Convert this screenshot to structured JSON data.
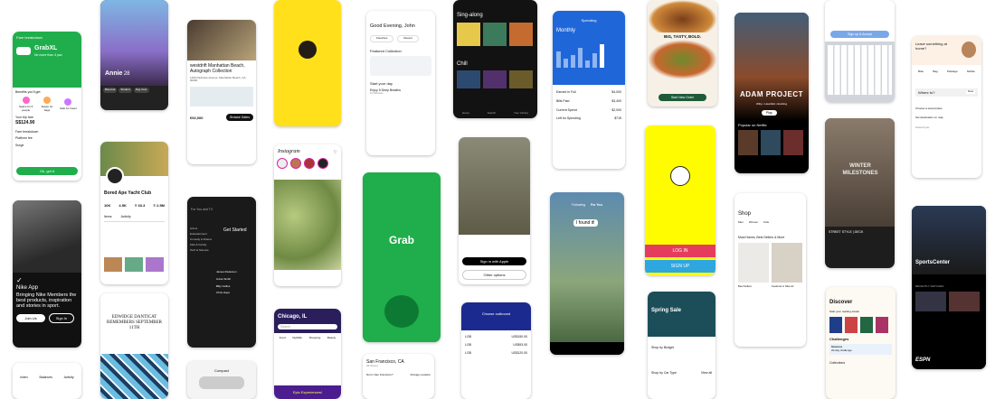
{
  "colors": {
    "grab": "#1fae4b",
    "snap": "#fffc00",
    "spend": "#1f66d9",
    "netflix": "#e50914"
  },
  "grabfood": {
    "title": "Fare breakdown",
    "tier": "GrabXL",
    "sub": "No more than 4 pax",
    "benefits": "Benefits you'll get:",
    "b1": "Space for 6 people",
    "b2": "Space for bags",
    "b3": "Safe for travel",
    "trip": "Your trip fare",
    "fare": "S$124.90",
    "rows": [
      "Fare breakdown",
      "Platform fee",
      "Surge"
    ],
    "cta": "Ok, got it"
  },
  "nike": {
    "title": "Nike App",
    "body": "Bringing Nike Members the best products, inspiration and stories in sport.",
    "join": "Join Us",
    "signin": "Sign In"
  },
  "bumble": {
    "name": "Annie",
    "age": "28",
    "tags": [
      "Bisexual",
      "Student",
      "Dog lover",
      "Rock"
    ]
  },
  "opensea": {
    "name": "Bored Ape Yacht Club",
    "stats": [
      "10K",
      "4.5K",
      "Ξ 63.3",
      "Ξ 2.5M"
    ],
    "tab": "Items",
    "tab2": "Activity"
  },
  "medium": {
    "headline": "EDWIDGE DANTICAT REMEMBERS SEPTEMBER 11TH"
  },
  "airbnb": {
    "title": "westdrift Manhattan Beach, Autograph Collection",
    "address": "1400 Parkview Avenue, Manhattan Beach, CA, 90266",
    "price": "€92,000",
    "cta": "Browse Dates"
  },
  "instagram": {
    "logo": "Instagram"
  },
  "tvapp": {
    "search": "For You and TV",
    "cta": "Get Started",
    "menu": [
      "Arts & Entertainment",
      "Comedy & Drama",
      "Kids & Family",
      "Tech & Science"
    ],
    "people": [
      "James Pederson",
      "Annie Smith",
      "Billy Collins",
      "Chris Hope"
    ]
  },
  "mailchimp": {
    "logo": "mailchimp"
  },
  "grab": {
    "logo": "Grab"
  },
  "yelp": {
    "city": "Chicago, IL",
    "search": "Search",
    "cats": [
      "Food",
      "Nightlife",
      "Shopping",
      "Beauty"
    ],
    "promo": "Epic Experiences!"
  },
  "calm": {
    "greet": "Good Evening, John",
    "chips": [
      "Favorites",
      "Recent"
    ],
    "featured": "Featured Collection",
    "start": "Start your day",
    "item": "Enjoy 5 Deep Breaths",
    "meta": "10 Minutes"
  },
  "sanfran": {
    "city": "San Francisco, CA",
    "sub": "All Stores",
    "q": "Not in San Francisco?",
    "change": "Change Location"
  },
  "spotify": {
    "section": "Sing-along",
    "section2": "Chill",
    "tabs": [
      "Home",
      "Search",
      "Your Library"
    ]
  },
  "apple": {
    "signin": " Sign in with Apple",
    "other": "Other options"
  },
  "flights": {
    "title": "Choose outbound",
    "rows": [
      [
        "LGB",
        "US$150.00"
      ],
      [
        "LGB",
        "US$93.00"
      ],
      [
        "LGB",
        "US$120.00"
      ]
    ]
  },
  "spending": {
    "title": "Spending",
    "toggle": "Monthly",
    "items": [
      [
        "Earned in Full",
        "$4,000"
      ],
      [
        "Bills Paid",
        "$3,400"
      ],
      [
        "Current Spend",
        "$2,000"
      ],
      [
        "Left for Spending",
        "$715"
      ]
    ]
  },
  "tiktok": {
    "tabs": [
      "Following",
      "For You"
    ],
    "caption": "I found it!"
  },
  "carrental": {
    "promo": "Spring Sale",
    "budget": "Shop by Budget",
    "type": "Shop by Car Type",
    "view": "View all"
  },
  "burger": {
    "headline": "BIG, TASTY, BOLD.",
    "cta": "Start New Order"
  },
  "snap": {
    "login": "LOG IN",
    "signup": "SIGN UP"
  },
  "shop": {
    "title": "Shop",
    "filters": [
      "Men",
      "Women",
      "Kids"
    ],
    "section": "Must Haves, Best Sellers & More",
    "items": [
      "Best Sellers",
      "Featured in Nike Air"
    ]
  },
  "netflix": {
    "title": "ADAM PROJECT",
    "tags": "Witty • Heartfelt • Exciting",
    "play": "Play",
    "section": "Popular on Netflix"
  },
  "fashion": {
    "title": "WINTER MILESTONES",
    "tag": "STREET STYLE | DECK"
  },
  "keyboard": {
    "cta": "Sign up & Accept"
  },
  "discover": {
    "title": "Discover",
    "sub": "Start your reading streak",
    "ch": "Challenges",
    "success": "Success",
    "days": "20-day challenge",
    "col": "Collections"
  },
  "booking": {
    "q": "Leave something at home?",
    "cats": [
      "Bike",
      "Bag",
      "Package",
      "Mobile"
    ],
    "where": "Where to?",
    "now": "Now",
    "addr": "Choose a saved place",
    "dest": "Set destination on map",
    "around": "Around you"
  },
  "espn": {
    "title": "SportsCenter",
    "cap": "RECENTLY WATCHED",
    "logo": "ESPN"
  },
  "compare": {
    "title": "Compact"
  },
  "golf": {
    "tabs": [
      "Index",
      "Balances",
      "Activity"
    ]
  }
}
